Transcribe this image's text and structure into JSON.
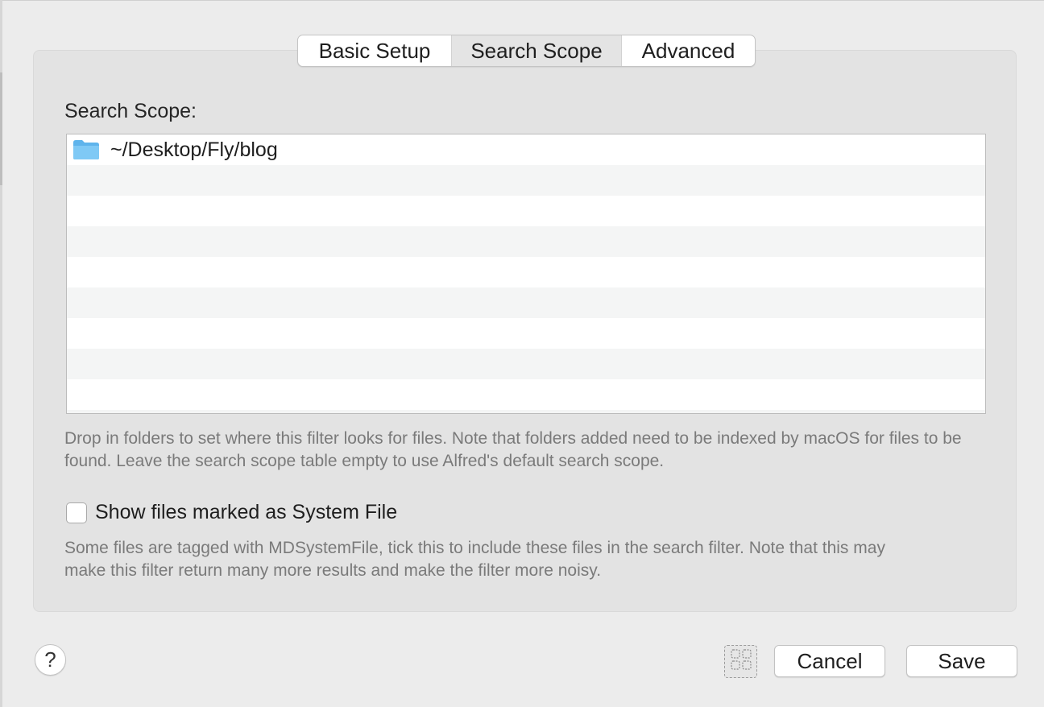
{
  "tabs": [
    {
      "label": "Basic Setup",
      "selected": false
    },
    {
      "label": "Search Scope",
      "selected": true
    },
    {
      "label": "Advanced",
      "selected": false
    }
  ],
  "scope": {
    "label": "Search Scope:",
    "rows": [
      {
        "icon": "folder-icon",
        "path": "~/Desktop/Fly/blog"
      }
    ],
    "help_text": "Drop in folders to set where this filter looks for files. Note that folders added need to be indexed by macOS for files to be found. Leave the search scope table empty to use Alfred's default search scope."
  },
  "system_file": {
    "label": "Show files marked as System File",
    "checked": false,
    "help_text": "Some files are tagged with MDSystemFile, tick this to include these files in the search filter. Note that this may make this filter return many more results and make the filter more noisy."
  },
  "footer": {
    "help_label": "?",
    "grid_icon": "grid-icon",
    "cancel_label": "Cancel",
    "save_label": "Save"
  },
  "colors": {
    "window_bg": "#ececec",
    "group_bg": "#e3e3e3",
    "row_alt": "#f4f5f5",
    "folder_blue": "#6cbdf0",
    "help_text": "#7a7a7a"
  }
}
